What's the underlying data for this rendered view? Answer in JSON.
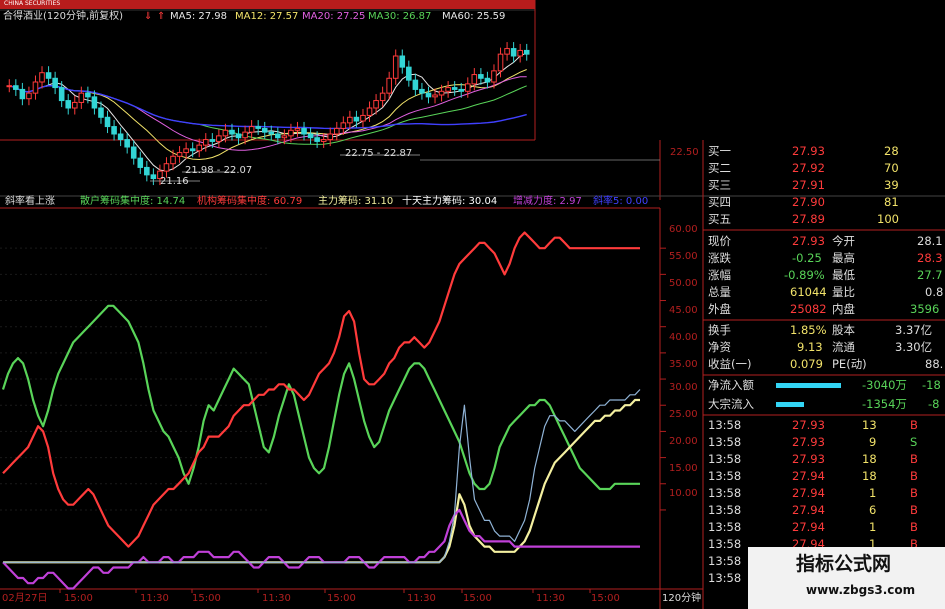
{
  "colors": {
    "bg": "#000000",
    "up": "#ff3b3b",
    "down": "#33d5d5",
    "ma5": "#e6e6e6",
    "ma12": "#f2e36a",
    "ma20": "#e060e0",
    "ma30": "#59d459",
    "ma60": "#4040ff",
    "axis": "#b21f1f",
    "purple": "#c040d8",
    "yellow": "#f4f0a0",
    "lightblue": "#8fb3d6",
    "cyan": "#33d5f5"
  },
  "title_bar": {
    "logo_text": "CHINA SECURITIES",
    "stock_name": "合得酒业(120分钟,前复权)",
    "ma5_label": "MA5: 27.98",
    "ma12_label": "MA12: 27.57",
    "ma20_label": "MA20: 27.25",
    "ma30_label": "MA30: 26.87",
    "ma60_label": "MA60: 25.59"
  },
  "kline": {
    "annotations": [
      "21.16",
      "21.98 - 22.07",
      "22.75 - 22.87"
    ],
    "axis_label": "22.50"
  },
  "indicator": {
    "name": "斜率看上涨",
    "s1": "散户筹码集中度: 14.74",
    "s2": "机构筹码集中度: 60.79",
    "s3": "主力筹码: 31.10",
    "s4": "十天主力筹码: 30.04",
    "s5": "增减力度: 2.97",
    "s6": "斜率5: 0.00",
    "axis_labels": [
      "60.00",
      "55.00",
      "50.00",
      "45.00",
      "40.00",
      "35.00",
      "30.00",
      "25.00",
      "20.00",
      "15.00",
      "10.00"
    ]
  },
  "time_axis": {
    "labels": [
      "02月27日",
      "15:00",
      "11:30",
      "15:00",
      "11:30",
      "15:00",
      "11:30",
      "15:00",
      "11:30",
      "15:00"
    ],
    "period": "120分钟"
  },
  "order_book": [
    {
      "label": "买一",
      "price": "27.93",
      "vol": "28"
    },
    {
      "label": "买二",
      "price": "27.92",
      "vol": "70"
    },
    {
      "label": "买三",
      "price": "27.91",
      "vol": "39"
    },
    {
      "label": "买四",
      "price": "27.90",
      "vol": "81"
    },
    {
      "label": "买五",
      "price": "27.89",
      "vol": "100"
    }
  ],
  "quote": [
    {
      "l1": "现价",
      "v1": "27.93",
      "l2": "今开",
      "v2": "28.1"
    },
    {
      "l1": "涨跌",
      "v1": "-0.25",
      "l2": "最高",
      "v2": "28.3"
    },
    {
      "l1": "涨幅",
      "v1": "-0.89%",
      "l2": "最低",
      "v2": "27.7"
    },
    {
      "l1": "总量",
      "v1": "61044",
      "l2": "量比",
      "v2": "0.8"
    },
    {
      "l1": "外盘",
      "v1": "25082",
      "l2": "内盘",
      "v2": "3596"
    }
  ],
  "stats": [
    {
      "l1": "换手",
      "v1": "1.85%",
      "l2": "股本",
      "v2": "3.37亿"
    },
    {
      "l1": "净资",
      "v1": "9.13",
      "l2": "流通",
      "v2": "3.30亿"
    },
    {
      "l1": "收益(一)",
      "v1": "0.079",
      "l2": "PE(动)",
      "v2": "88."
    }
  ],
  "flows": [
    {
      "label": "净流入额",
      "value": "-3040万",
      "pct": "-18"
    },
    {
      "label": "大宗流入",
      "value": "-1354万",
      "pct": "-8"
    }
  ],
  "trades": [
    {
      "time": "13:58",
      "price": "27.93",
      "vol": "13",
      "side": "B"
    },
    {
      "time": "13:58",
      "price": "27.93",
      "vol": "9",
      "side": "S"
    },
    {
      "time": "13:58",
      "price": "27.93",
      "vol": "18",
      "side": "B"
    },
    {
      "time": "13:58",
      "price": "27.94",
      "vol": "18",
      "side": "B"
    },
    {
      "time": "13:58",
      "price": "27.94",
      "vol": "1",
      "side": "B"
    },
    {
      "time": "13:58",
      "price": "27.94",
      "vol": "6",
      "side": "B"
    },
    {
      "time": "13:58",
      "price": "27.94",
      "vol": "1",
      "side": "B"
    },
    {
      "time": "13:58",
      "price": "27.94",
      "vol": "1",
      "side": "B"
    },
    {
      "time": "13:58",
      "price": "27.94",
      "vol": "1",
      "side": "B"
    },
    {
      "time": "13:58",
      "price": "27.94",
      "vol": "1",
      "side": "B"
    }
  ],
  "watermark": {
    "title": "指标公式网",
    "url": "www.zbgs3.com"
  },
  "chart_data": {
    "type": "line",
    "title": "斜率看上涨",
    "x": [
      0,
      1,
      2,
      3,
      4,
      5,
      6,
      7,
      8,
      9,
      10,
      11,
      12,
      13,
      14,
      15,
      16,
      17,
      18,
      19,
      20,
      21,
      22,
      23,
      24,
      25,
      26,
      27,
      28,
      29,
      30,
      31,
      32,
      33,
      34,
      35,
      36,
      37,
      38,
      39,
      40,
      41,
      42,
      43,
      44,
      45,
      46,
      47,
      48,
      49,
      50,
      51,
      52,
      53,
      54,
      55,
      56,
      57,
      58,
      59,
      60,
      61,
      62,
      63,
      64,
      65,
      66,
      67,
      68,
      69,
      70,
      71,
      72,
      73,
      74,
      75,
      76,
      77,
      78,
      79,
      80,
      81,
      82,
      83,
      84,
      85,
      86,
      87,
      88,
      89,
      90,
      91,
      92,
      93,
      94,
      95,
      96,
      97,
      98,
      99,
      100,
      101,
      102,
      103,
      104,
      105,
      106,
      107,
      108,
      109,
      110,
      111,
      112,
      113,
      114,
      115,
      116,
      117,
      118,
      119,
      120,
      121,
      122,
      123,
      124,
      125,
      126,
      127
    ],
    "series": [
      {
        "name": "散户筹码集中度",
        "color": "#59d459",
        "values": [
          33,
          36,
          38,
          39,
          38,
          35,
          31,
          28,
          26,
          29,
          33,
          36,
          38,
          40,
          42,
          43,
          44,
          45,
          46,
          47,
          48,
          49,
          49,
          48,
          47,
          46,
          44,
          42,
          38,
          33,
          29,
          27,
          25,
          24,
          22,
          20,
          17,
          15,
          18,
          22,
          27,
          30,
          29,
          31,
          33,
          35,
          37,
          36,
          35,
          34,
          30,
          26,
          22,
          21,
          24,
          28,
          31,
          34,
          32,
          28,
          24,
          20,
          18,
          17,
          18,
          22,
          27,
          32,
          36,
          38,
          35,
          31,
          27,
          24,
          22,
          23,
          26,
          29,
          31,
          33,
          35,
          37,
          38,
          38,
          37,
          35,
          33,
          31,
          29,
          27,
          25,
          23,
          20,
          17,
          15,
          14,
          14,
          15,
          18,
          22,
          24,
          26,
          27,
          28,
          29,
          30,
          30,
          31,
          31,
          30,
          28,
          26,
          24,
          22,
          20,
          18,
          17,
          16,
          15,
          14,
          14,
          14,
          15,
          15,
          15,
          15,
          15,
          15
        ]
      },
      {
        "name": "机构筹码集中度",
        "color": "#ff3b3b",
        "values": [
          17,
          18,
          19,
          20,
          21,
          22,
          24,
          26,
          25,
          22,
          17,
          14,
          12,
          11,
          11,
          12,
          13,
          14,
          13,
          11,
          9,
          7,
          6,
          5,
          4,
          3,
          4,
          5,
          7,
          9,
          11,
          12,
          13,
          14,
          14,
          15,
          16,
          17,
          19,
          21,
          22,
          24,
          24,
          24,
          25,
          26,
          28,
          29,
          30,
          30,
          31,
          32,
          32,
          33,
          33,
          34,
          34,
          33,
          33,
          32,
          31,
          32,
          34,
          36,
          37,
          38,
          40,
          43,
          47,
          48,
          46,
          40,
          35,
          34,
          34,
          35,
          36,
          38,
          39,
          41,
          42,
          42,
          43,
          42,
          41,
          42,
          44,
          46,
          49,
          52,
          55,
          57,
          58,
          59,
          60,
          61,
          61,
          60,
          59,
          57,
          55,
          57,
          60,
          62,
          63,
          62,
          61,
          60,
          60,
          61,
          62,
          62,
          61,
          60,
          60,
          60,
          60,
          60,
          60,
          60,
          60,
          60,
          60,
          60,
          60,
          60,
          60,
          60
        ]
      },
      {
        "name": "主力筹码",
        "color": "#f4f0a0",
        "values": [
          0,
          0,
          0,
          0,
          0,
          0,
          0,
          0,
          0,
          0,
          0,
          0,
          0,
          0,
          0,
          0,
          0,
          0,
          0,
          0,
          0,
          0,
          0,
          0,
          0,
          0,
          0,
          0,
          0,
          0,
          0,
          0,
          0,
          0,
          0,
          0,
          0,
          0,
          0,
          0,
          0,
          0,
          0,
          0,
          0,
          0,
          0,
          0,
          0,
          0,
          0,
          0,
          0,
          0,
          0,
          0,
          0,
          0,
          0,
          0,
          0,
          0,
          0,
          0,
          0,
          0,
          0,
          0,
          0,
          0,
          0,
          0,
          0,
          0,
          0,
          0,
          0,
          0,
          0,
          0,
          0,
          0,
          0,
          0,
          0,
          0,
          0,
          0,
          1,
          3,
          7,
          13,
          11,
          7,
          5,
          4,
          3,
          3,
          2,
          2,
          2,
          2,
          2,
          3,
          4,
          6,
          9,
          12,
          15,
          17,
          19,
          20,
          21,
          22,
          23,
          24,
          25,
          26,
          27,
          27,
          28,
          28,
          29,
          29,
          30,
          30,
          31,
          31
        ]
      },
      {
        "name": "增减力度",
        "color": "#c040d8",
        "values": [
          0,
          -1,
          -2,
          -3,
          -3,
          -4,
          -4,
          -3,
          -3,
          -2,
          -2,
          -3,
          -4,
          -5,
          -5,
          -4,
          -3,
          -2,
          -1,
          -1,
          -2,
          -2,
          -1,
          -1,
          -1,
          -1,
          0,
          0,
          1,
          0,
          0,
          0,
          1,
          1,
          0,
          0,
          1,
          1,
          1,
          2,
          2,
          2,
          1,
          1,
          1,
          1,
          2,
          2,
          1,
          0,
          -1,
          -1,
          0,
          1,
          1,
          1,
          0,
          -1,
          -1,
          -1,
          0,
          1,
          1,
          1,
          0,
          0,
          0,
          0,
          0,
          1,
          1,
          1,
          0,
          -1,
          -1,
          0,
          1,
          1,
          1,
          1,
          1,
          0,
          0,
          1,
          1,
          2,
          2,
          3,
          4,
          7,
          9,
          10,
          8,
          6,
          5,
          5,
          4,
          4,
          4,
          4,
          4,
          4,
          3,
          3,
          3,
          3,
          3,
          3,
          3,
          3,
          3,
          3,
          3,
          3,
          3,
          3,
          3,
          3,
          3,
          3,
          3,
          3,
          3,
          3,
          3,
          3,
          3,
          3
        ]
      },
      {
        "name": "十天主力筹码",
        "color": "#8fb3d6",
        "values": [
          0,
          0,
          0,
          0,
          0,
          0,
          0,
          0,
          0,
          0,
          0,
          0,
          0,
          0,
          0,
          0,
          0,
          0,
          0,
          0,
          0,
          0,
          0,
          0,
          0,
          0,
          0,
          0,
          0,
          0,
          0,
          0,
          0,
          0,
          0,
          0,
          0,
          0,
          0,
          0,
          0,
          0,
          0,
          0,
          0,
          0,
          0,
          0,
          0,
          0,
          0,
          0,
          0,
          0,
          0,
          0,
          0,
          0,
          0,
          0,
          0,
          0,
          0,
          0,
          0,
          0,
          0,
          0,
          0,
          0,
          0,
          0,
          0,
          0,
          0,
          0,
          0,
          0,
          0,
          0,
          0,
          0,
          0,
          0,
          0,
          0,
          0,
          0,
          1,
          4,
          9,
          22,
          30,
          20,
          12,
          10,
          8,
          8,
          6,
          5,
          5,
          5,
          4,
          6,
          8,
          12,
          18,
          22,
          26,
          28,
          28,
          27,
          27,
          26,
          25,
          26,
          27,
          28,
          29,
          30,
          30,
          31,
          31,
          31,
          31,
          32,
          32,
          33
        ]
      }
    ],
    "ylim": [
      -3,
      65
    ],
    "y_ticks": [
      10,
      15,
      20,
      25,
      30,
      35,
      40,
      45,
      50,
      55,
      60
    ]
  }
}
